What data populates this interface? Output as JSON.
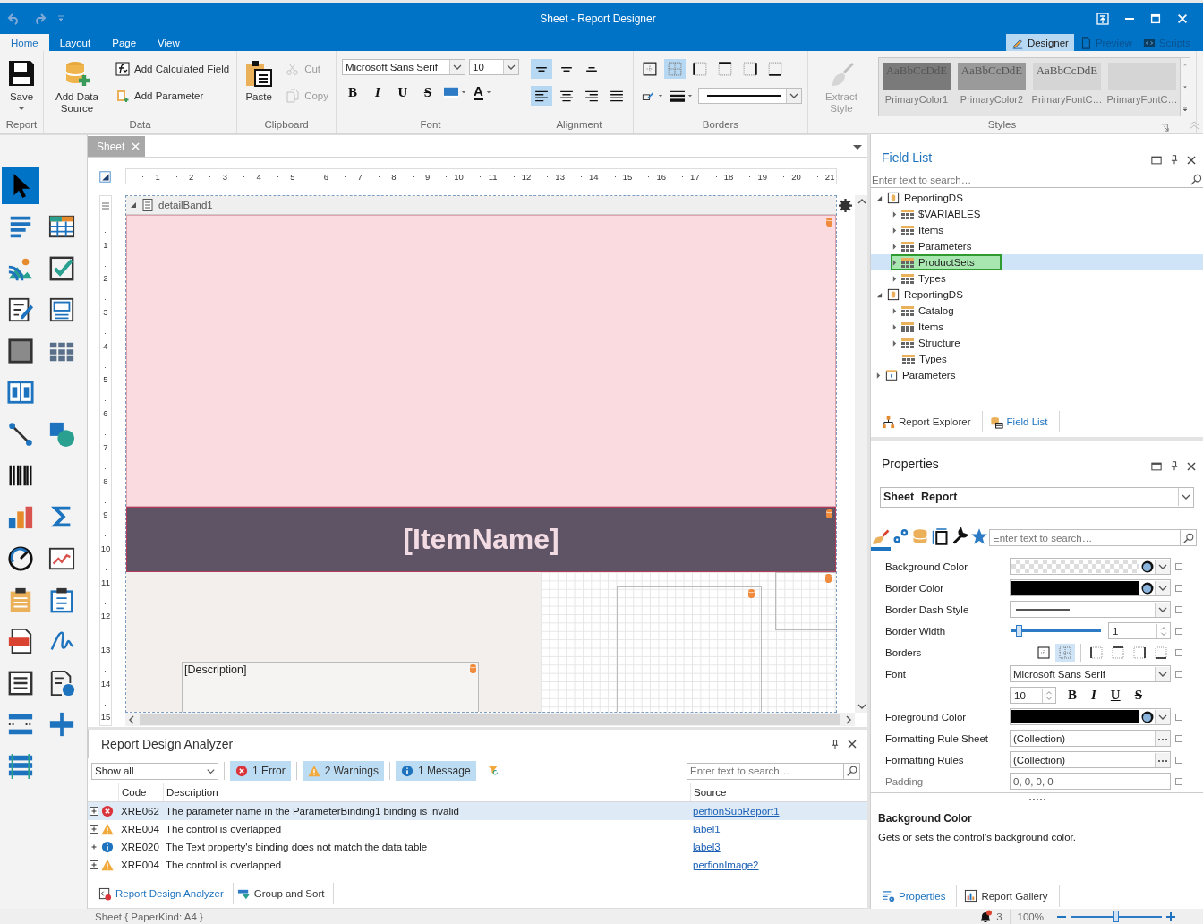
{
  "window": {
    "title": "Sheet - Report Designer"
  },
  "ribbon_tabs": [
    {
      "label": "Home",
      "selected": true
    },
    {
      "label": "Layout",
      "selected": false
    },
    {
      "label": "Page",
      "selected": false
    },
    {
      "label": "View",
      "selected": false
    }
  ],
  "view_tabs": [
    {
      "label": "Designer",
      "selected": true
    },
    {
      "label": "Preview",
      "selected": false
    },
    {
      "label": "Scripts",
      "selected": false
    }
  ],
  "ribbon": {
    "groups": [
      {
        "label": "Report",
        "kind": "stack",
        "items": [
          {
            "kind": "large",
            "label": "Save",
            "dropdown": true,
            "disabled": false
          }
        ]
      },
      {
        "label": "Data",
        "kind": "stack",
        "items": [
          {
            "kind": "large",
            "label": "Add Data Source",
            "dropdown": false,
            "disabled": false
          },
          {
            "kind": "small",
            "label": "Add Calculated Field",
            "disabled": false
          },
          {
            "kind": "small",
            "label": "Add Parameter",
            "disabled": false
          }
        ]
      },
      {
        "label": "Clipboard",
        "kind": "stack",
        "items": [
          {
            "kind": "large",
            "label": "Paste",
            "dropdown": false,
            "disabled": false
          },
          {
            "kind": "small",
            "label": "Cut",
            "disabled": true
          },
          {
            "kind": "small",
            "label": "Copy",
            "disabled": true
          }
        ]
      },
      {
        "label": "Font",
        "kind": "lines",
        "lines": [
          {
            "items": [
              {
                "kind": "combo",
                "value": "Microsoft Sans Serif"
              },
              {
                "kind": "combo",
                "value": "10"
              }
            ]
          },
          {
            "items": [
              {
                "kind": "bold",
                "glyph": "B"
              },
              {
                "kind": "italic",
                "glyph": "I"
              },
              {
                "kind": "underline",
                "glyph": "U"
              },
              {
                "kind": "strike",
                "glyph": "S"
              },
              {
                "kind": "icon-dropdown"
              },
              {
                "kind": "font-color",
                "glyph": "A"
              }
            ]
          }
        ]
      },
      {
        "label": "Alignment",
        "kind": "lines",
        "lines": [
          {
            "items": [
              {
                "kind": "toggle",
                "selected": true
              },
              {
                "kind": "toggle",
                "selected": false
              },
              {
                "kind": "toggle",
                "selected": false
              }
            ]
          },
          {
            "items": [
              {
                "kind": "toggle",
                "selected": true
              },
              {
                "kind": "toggle",
                "selected": false
              },
              {
                "kind": "toggle",
                "selected": false
              },
              {
                "kind": "toggle",
                "selected": false
              }
            ]
          }
        ]
      },
      {
        "label": "Borders",
        "kind": "lines",
        "lines": [
          {
            "items": [
              {
                "kind": "toggle",
                "selected": false
              },
              {
                "kind": "toggle",
                "selected": true
              },
              {
                "kind": "toggle",
                "selected": false
              },
              {
                "kind": "toggle",
                "selected": false
              },
              {
                "kind": "toggle",
                "selected": false
              },
              {
                "kind": "toggle",
                "selected": false
              }
            ]
          },
          {
            "items": [
              {
                "kind": "icon-dropdown"
              },
              {
                "kind": "icon-dropdown"
              },
              {
                "kind": "line-combo"
              }
            ]
          }
        ]
      },
      {
        "label": "Styles",
        "kind": "stack",
        "items": [
          {
            "kind": "large",
            "label": "Extract Style",
            "dropdown": false,
            "disabled": true
          },
          {
            "kind": "gallery",
            "items": [
              {
                "sample": "AaBbCcDdE",
                "label": "PrimaryColor1",
                "color": "#7a7a7a"
              },
              {
                "sample": "AaBbCcDdE",
                "label": "PrimaryColor2",
                "color": "#9a9a9a"
              },
              {
                "sample": "AaBbCcDdE",
                "label": "PrimaryFontC…",
                "color": "#d5d5d5"
              },
              {
                "label": "PrimaryFontC…",
                "color": "#d5d5d5"
              }
            ]
          }
        ]
      }
    ]
  },
  "toolbox": {
    "lines": [
      {
        "tools": [
          {
            "selected": true
          }
        ]
      },
      {
        "tools": [
          {
            "selected": false
          },
          {
            "selected": false
          }
        ]
      },
      {
        "tools": [
          {
            "selected": false
          },
          {
            "selected": false
          }
        ]
      },
      {
        "tools": [
          {
            "selected": false
          },
          {
            "selected": false
          }
        ]
      },
      {
        "tools": [
          {
            "selected": false
          },
          {
            "selected": false
          }
        ]
      },
      {
        "tools": [
          {
            "selected": false
          }
        ]
      },
      {
        "tools": [
          {
            "selected": false
          },
          {
            "selected": false
          }
        ]
      },
      {
        "tools": [
          {
            "selected": false
          }
        ]
      },
      {
        "tools": [
          {
            "selected": false
          },
          {
            "selected": false
          }
        ]
      },
      {
        "tools": [
          {
            "selected": false
          },
          {
            "selected": false
          }
        ]
      },
      {
        "tools": [
          {
            "selected": false
          },
          {
            "selected": false
          }
        ]
      },
      {
        "tools": [
          {
            "selected": false
          },
          {
            "selected": false
          }
        ]
      },
      {
        "tools": [
          {
            "selected": false
          },
          {
            "selected": false
          }
        ]
      },
      {
        "tools": [
          {
            "selected": false
          },
          {
            "selected": false
          }
        ]
      },
      {
        "tools": [
          {
            "selected": false
          }
        ]
      }
    ]
  },
  "designer": {
    "tab": {
      "label": "Sheet",
      "selected": true
    },
    "ruler": [
      "1",
      "2",
      "3",
      "4",
      "5",
      "6",
      "7",
      "8",
      "9",
      "10",
      "11",
      "12",
      "13",
      "14",
      "15",
      "16",
      "17",
      "18",
      "19",
      "20",
      "21"
    ],
    "vruler": [
      "1",
      "2",
      "3",
      "4",
      "5",
      "6",
      "7",
      "8",
      "9",
      "10",
      "11",
      "12",
      "13",
      "14",
      "15"
    ],
    "band": {
      "label": "detailBand1",
      "expanded": true
    },
    "item_name": "[ItemName]",
    "description": "[Description]"
  },
  "analyzer": {
    "title": "Report Design Analyzer",
    "filter": "Show all",
    "toggles": [
      {
        "kind": "error",
        "label": "1 Error",
        "selected": true
      },
      {
        "kind": "warning",
        "label": "2 Warnings",
        "selected": true
      },
      {
        "kind": "info",
        "label": "1 Message",
        "selected": true
      }
    ],
    "search": {
      "placeholder": "Enter text to search…"
    },
    "columns": [
      "Code",
      "Description",
      "Source"
    ],
    "rows": [
      {
        "kind": "error",
        "code": "XRE062",
        "description": "The parameter name in the ParameterBinding1 binding is invalid",
        "source": "perfionSubReport1",
        "selected": true
      },
      {
        "kind": "warning",
        "code": "XRE004",
        "description": "The control is overlapped",
        "source": "label1",
        "selected": false
      },
      {
        "kind": "info",
        "code": "XRE020",
        "description": "The Text property's binding does not match the data table",
        "source": "label3",
        "selected": false
      },
      {
        "kind": "warning",
        "code": "XRE004",
        "description": "The control is overlapped",
        "source": "perfionImage2",
        "selected": false
      }
    ],
    "tabs": [
      {
        "label": "Report Design Analyzer",
        "selected": true
      },
      {
        "label": "Group and Sort",
        "selected": false
      }
    ]
  },
  "field_list": {
    "title": "Field List",
    "search": {
      "placeholder": "Enter text to search…"
    },
    "tree": [
      {
        "kind": "datasource",
        "label": "ReportingDS",
        "expanded": true,
        "selected": false,
        "highlighted": false,
        "children": [
          {
            "kind": "table",
            "label": "$VARIABLES",
            "expanded": false,
            "selected": false,
            "highlighted": false
          },
          {
            "kind": "table",
            "label": "Items",
            "expanded": false,
            "selected": false,
            "highlighted": false
          },
          {
            "kind": "table",
            "label": "Parameters",
            "expanded": false,
            "selected": false,
            "highlighted": false
          },
          {
            "kind": "table",
            "label": "ProductSets",
            "expanded": false,
            "selected": true,
            "highlighted": true
          },
          {
            "kind": "table",
            "label": "Types",
            "expanded": false,
            "selected": false,
            "highlighted": false
          }
        ]
      },
      {
        "kind": "datasource",
        "label": "ReportingDS",
        "expanded": true,
        "selected": false,
        "highlighted": false,
        "children": [
          {
            "kind": "table",
            "label": "Catalog",
            "expanded": false,
            "selected": false,
            "highlighted": false
          },
          {
            "kind": "table",
            "label": "Items",
            "expanded": false,
            "selected": false,
            "highlighted": false
          },
          {
            "kind": "table",
            "label": "Structure",
            "expanded": false,
            "selected": false,
            "highlighted": false
          },
          {
            "kind": "table",
            "label": "Types",
            "selected": false,
            "highlighted": false
          }
        ]
      },
      {
        "kind": "parameters",
        "label": "Parameters",
        "expanded": false,
        "selected": false,
        "highlighted": false
      }
    ],
    "tabs": [
      {
        "label": "Report Explorer",
        "selected": false
      },
      {
        "label": "Field List",
        "selected": true
      }
    ]
  },
  "properties": {
    "title": "Properties",
    "selector": {
      "name": "Sheet",
      "type": "Report"
    },
    "categories": [
      {
        "selected": true
      },
      {
        "selected": false
      },
      {
        "selected": false
      },
      {
        "selected": false
      },
      {
        "selected": false
      },
      {
        "selected": false
      }
    ],
    "search": {
      "placeholder": "Enter text to search…"
    },
    "rows": [
      {
        "kind": "color",
        "label": "Background Color",
        "transparent": true
      },
      {
        "kind": "color",
        "label": "Border Color",
        "transparent": false,
        "color": "#000000"
      },
      {
        "kind": "dash",
        "label": "Border Dash Style"
      },
      {
        "kind": "slider",
        "label": "Border Width",
        "level": 0.08,
        "value": "1"
      },
      {
        "kind": "borders",
        "label": "Borders",
        "buttons": [
          {
            "selected": false
          },
          {
            "selected": true
          },
          {
            "selected": false
          },
          {
            "selected": false
          },
          {
            "selected": false
          },
          {
            "selected": false
          }
        ]
      },
      {
        "kind": "font",
        "label": "Font",
        "value": "Microsoft Sans Serif",
        "size": "10",
        "styles": [
          {
            "kind": "bold",
            "glyph": "B"
          },
          {
            "kind": "italic",
            "glyph": "I"
          },
          {
            "kind": "underline",
            "glyph": "U"
          },
          {
            "kind": "strike",
            "glyph": "S"
          }
        ]
      },
      {
        "kind": "color",
        "label": "Foreground Color",
        "transparent": false,
        "color": "#000000"
      },
      {
        "kind": "collection",
        "label": "Formatting Rule Sheet",
        "value": "(Collection)"
      },
      {
        "kind": "collection",
        "label": "Formatting Rules",
        "value": "(Collection)"
      },
      {
        "kind": "text",
        "label": "Padding",
        "value": "0, 0, 0, 0"
      }
    ],
    "description": {
      "title": "Background Color",
      "text": "Gets or sets the control’s background color."
    },
    "tabs": [
      {
        "label": "Properties",
        "selected": true
      },
      {
        "label": "Report Gallery",
        "selected": false
      }
    ]
  },
  "status_bar": {
    "text": "Sheet { PaperKind: A4 }",
    "notifications": "3",
    "zoom": "100%",
    "zoom_slider": {
      "level": 0.5
    }
  }
}
